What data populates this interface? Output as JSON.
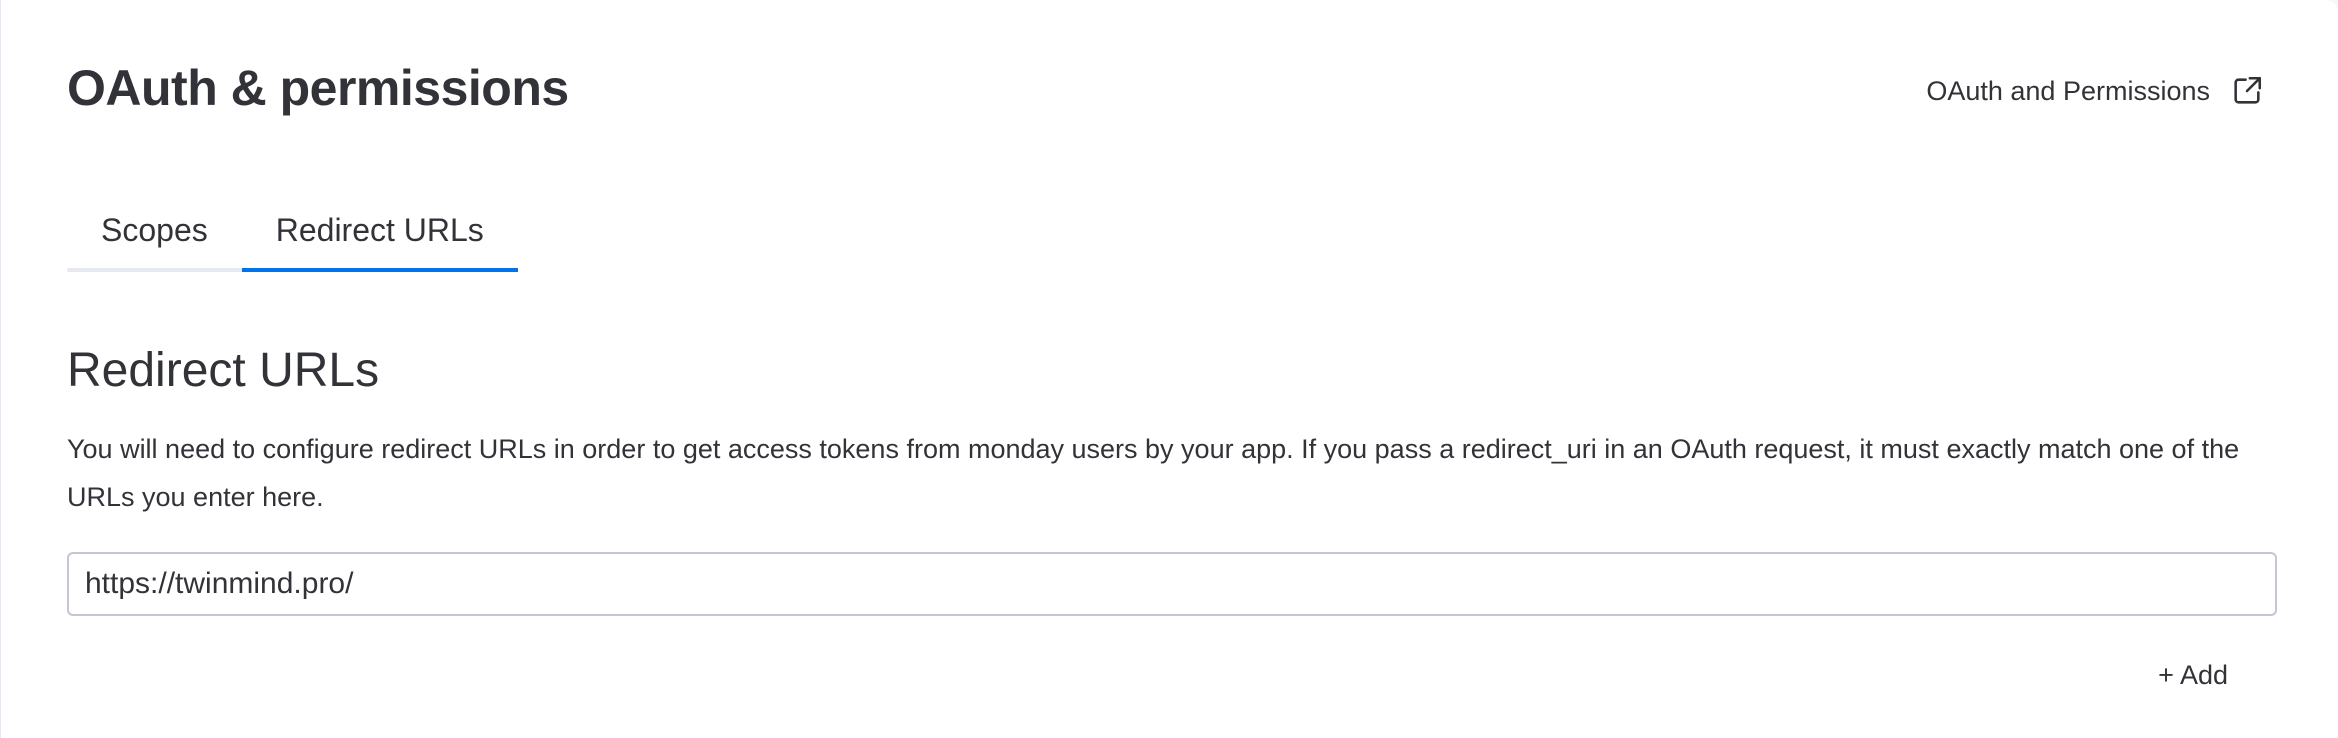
{
  "header": {
    "title": "OAuth & permissions",
    "doc_link_label": "OAuth and Permissions",
    "doc_link_icon": "external-link-icon"
  },
  "tabs": [
    {
      "label": "Scopes",
      "active": false
    },
    {
      "label": "Redirect URLs",
      "active": true
    }
  ],
  "section": {
    "title": "Redirect URLs",
    "description": "You will need to configure redirect URLs in order to get access tokens from monday users by your app. If you pass a redirect_uri in an OAuth request, it must exactly match one of the URLs you enter here."
  },
  "redirect_urls": [
    {
      "value": "https://twinmind.pro/"
    }
  ],
  "add_button_label": "+ Add",
  "colors": {
    "accent": "#0073ea",
    "text": "#323338",
    "tab_track": "#e6e9ef",
    "input_border": "#c3c6d4"
  }
}
